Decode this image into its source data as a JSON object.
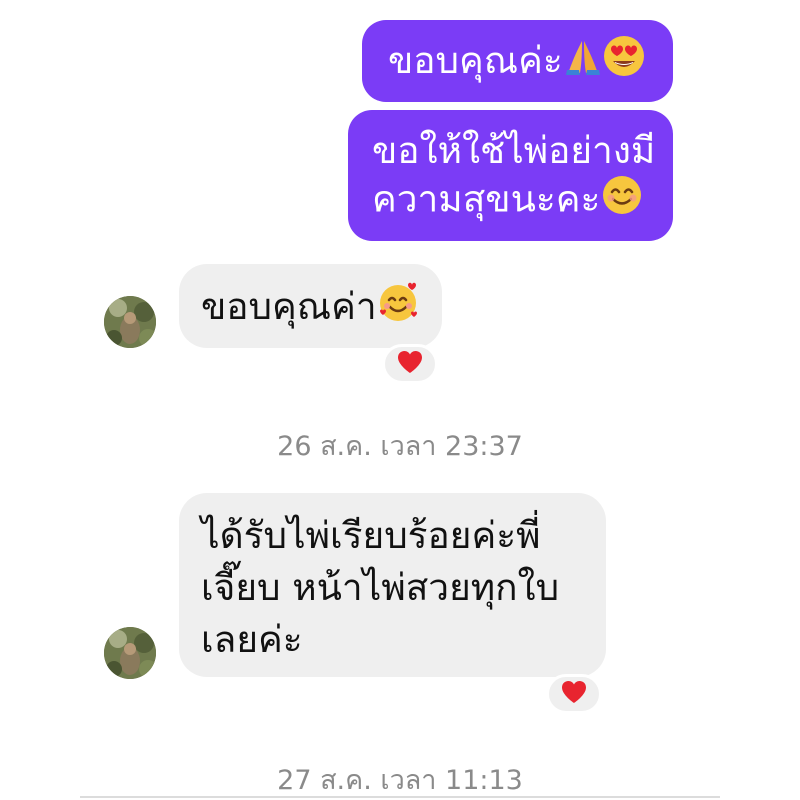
{
  "messages": [
    {
      "direction": "out",
      "text": "ขอบคุณค่ะ",
      "emoji": [
        "folded-hands",
        "heart-eyes"
      ]
    },
    {
      "direction": "out",
      "lines": [
        "ขอให้ใช้ไพ่อย่างมี",
        "ความสุขนะคะ"
      ],
      "emoji": [
        "smiling-face"
      ]
    },
    {
      "direction": "in",
      "text": "ขอบคุณค่า",
      "emoji": [
        "smiling-face-with-hearts"
      ],
      "reaction": "heart"
    },
    {
      "direction": "in",
      "lines": [
        "ได้รับไพ่เรียบร้อยค่ะพี่",
        "เจี๊ยบ หน้าไพ่สวยทุกใบ",
        "เลยค่ะ"
      ],
      "reaction": "heart"
    }
  ],
  "timestamps": [
    "26 ส.ค. เวลา 23:37",
    "27 ส.ค. เวลา 11:13"
  ],
  "colors": {
    "outgoing_bubble": "#7b3cf6",
    "incoming_bubble": "#efefef",
    "timestamp_text": "#8a8a8a",
    "reaction_heart": "#e8242f"
  }
}
